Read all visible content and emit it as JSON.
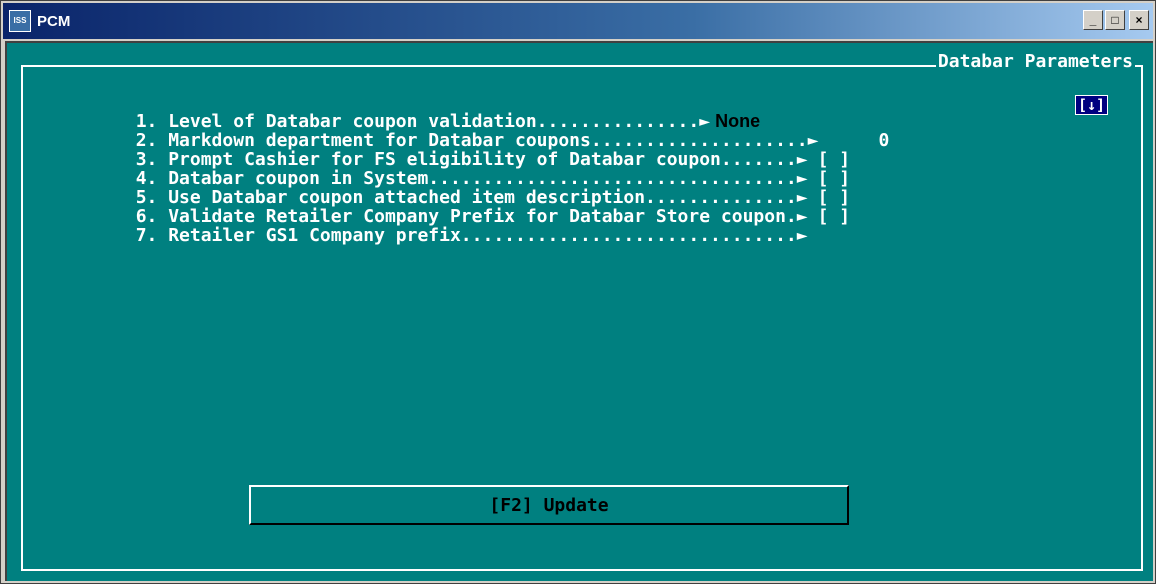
{
  "window": {
    "icon_text": "ISS",
    "title": "PCM",
    "minimize_glyph": "_",
    "maximize_glyph": "□",
    "close_glyph": "×"
  },
  "panel": {
    "title": "Databar Parameters",
    "dropdown_glyph": "[↓]"
  },
  "parameters": [
    {
      "label": "1. Level of Databar coupon validation...............",
      "arrow": "►",
      "value": " None"
    },
    {
      "label": "2. Markdown department for Databar coupons....................",
      "arrow": "►",
      "value": "0"
    },
    {
      "label": "3. Prompt Cashier for FS eligibility of Databar coupon.......",
      "arrow": "►",
      "value": "[ ]"
    },
    {
      "label": "4. Databar coupon in System..................................",
      "arrow": "►",
      "value": "[ ]"
    },
    {
      "label": "5. Use Databar coupon attached item description..............",
      "arrow": "►",
      "value": "[ ]"
    },
    {
      "label": "6. Validate Retailer Company Prefix for Databar Store coupon.",
      "arrow": "►",
      "value": "[ ]"
    },
    {
      "label": "7. Retailer GS1 Company prefix...............................",
      "arrow": "►",
      "value": ""
    }
  ],
  "update_button": {
    "label": "[F2] Update"
  },
  "colors": {
    "console_bg": "#008080",
    "frame": "#ffffff",
    "titlebar": "#0a246a"
  }
}
